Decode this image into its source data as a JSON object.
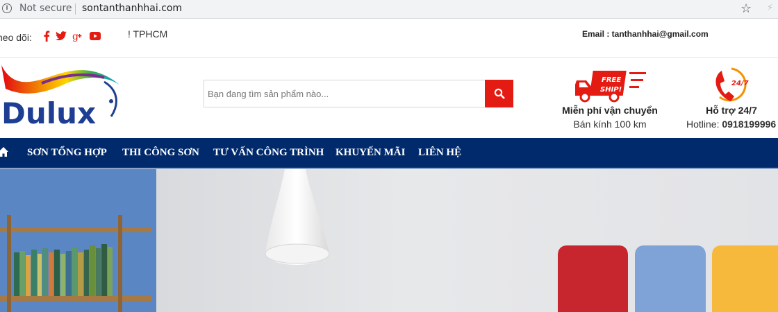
{
  "browser": {
    "security_label": "Not secure",
    "url": "sontanthanhhai.com"
  },
  "topbar": {
    "follow_label": "heo dõi:",
    "social_icons": [
      "facebook-icon",
      "twitter-icon",
      "google-plus-icon",
      "youtube-icon"
    ],
    "address": "! TPHCM",
    "email": "Email : tanthanhhai@gmail.com"
  },
  "header": {
    "logo_text": "Dulux",
    "search": {
      "placeholder": "Bạn đang tìm sản phẩm nào..."
    },
    "shipping": {
      "badge": "FREE SHIP!",
      "title": "Miễn phí vận chuyển",
      "subtitle": "Bán kính 100 km"
    },
    "support": {
      "badge": "24/7",
      "title": "Hỗ trợ 24/7",
      "hotline_label": "Hotline: ",
      "hotline_number": "0918199996"
    }
  },
  "nav": {
    "items": [
      {
        "label": "SƠN TỔNG HỢP"
      },
      {
        "label": "THI CÔNG SƠN"
      },
      {
        "label": "TƯ VẤN CÔNG TRÌNH"
      },
      {
        "label": "KHUYẾN MÃI"
      },
      {
        "label": "LIÊN HỆ"
      }
    ]
  },
  "colors": {
    "accent_red": "#e41b13",
    "nav_blue": "#002a6c",
    "swatch_red": "#c8262e",
    "swatch_blue": "#7fa3d6",
    "swatch_yellow": "#f6b93b"
  }
}
